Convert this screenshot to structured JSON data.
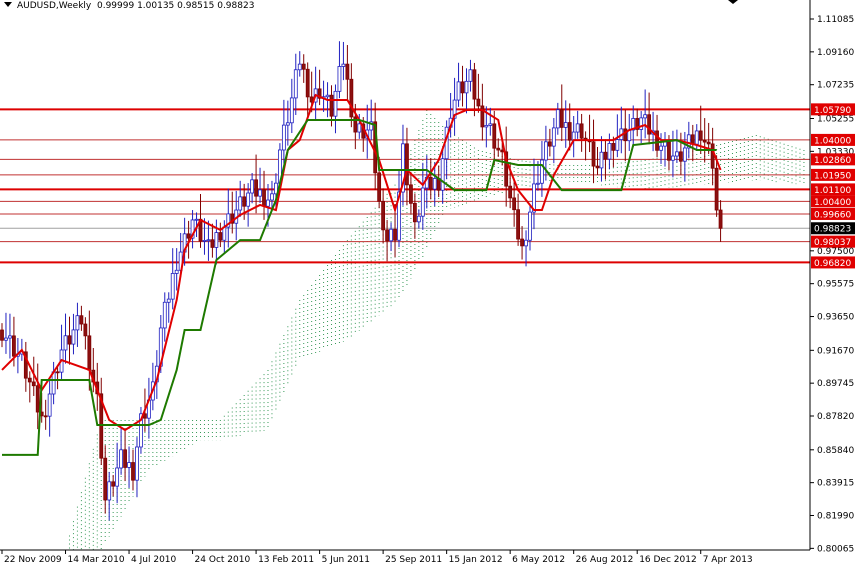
{
  "header": {
    "symbol": "AUDUSD,Weekly",
    "ohlc": "0.99999 1.00135 0.98515 0.98823"
  },
  "chart_data": {
    "type": "candlestick",
    "title": "AUDUSD,Weekly",
    "x_unit": "weeks since 22 Nov 2009",
    "ylim": [
      0.7997,
      1.1218
    ],
    "y_ticks": [
      "1.11085",
      "1.09160",
      "1.07235",
      "1.05255",
      "1.03330",
      "0.97500",
      "0.95575",
      "0.93650",
      "0.91670",
      "0.89745",
      "0.87820",
      "0.85840",
      "0.83915",
      "0.81990",
      "0.80065"
    ],
    "x_ticks": [
      {
        "week": 0,
        "label": "22 Nov 2009"
      },
      {
        "week": 16,
        "label": "14 Mar 2010"
      },
      {
        "week": 32,
        "label": "4 Jul 2010"
      },
      {
        "week": 48,
        "label": "24 Oct 2010"
      },
      {
        "week": 64,
        "label": "13 Feb 2011"
      },
      {
        "week": 80,
        "label": "5 Jun 2011"
      },
      {
        "week": 96,
        "label": "25 Sep 2011"
      },
      {
        "week": 112,
        "label": "15 Jan 2012"
      },
      {
        "week": 128,
        "label": "6 May 2012"
      },
      {
        "week": 144,
        "label": "26 Aug 2012"
      },
      {
        "week": 160,
        "label": "16 Dec 2012"
      },
      {
        "week": 176,
        "label": "7 Apr 2013"
      }
    ],
    "current_price": {
      "value": 0.98823,
      "label": "0.98823"
    },
    "levels": [
      {
        "value": 1.0579,
        "label": "1.05790",
        "thick": true
      },
      {
        "value": 1.04,
        "label": "1.04000",
        "thick": false
      },
      {
        "value": 1.0286,
        "label": "1.02860",
        "thick": false
      },
      {
        "value": 1.0195,
        "label": "1.01950",
        "thick": false
      },
      {
        "value": 1.011,
        "label": "1.01100",
        "thick": true
      },
      {
        "value": 1.004,
        "label": "1.00400",
        "thick": false
      },
      {
        "value": 0.9966,
        "label": "0.99660",
        "thick": false
      },
      {
        "value": 0.98037,
        "label": "0.98037",
        "thick": false
      },
      {
        "value": 0.9682,
        "label": "0.96820",
        "thick": true
      }
    ],
    "close_keypoints": [
      [
        0,
        0.9286
      ],
      [
        5,
        0.911
      ],
      [
        10,
        0.8759
      ],
      [
        15,
        0.9169
      ],
      [
        20,
        0.9345
      ],
      [
        24,
        0.8876
      ],
      [
        26,
        0.829
      ],
      [
        30,
        0.8524
      ],
      [
        33,
        0.8466
      ],
      [
        35,
        0.8759
      ],
      [
        38,
        0.8934
      ],
      [
        40,
        0.9286
      ],
      [
        44,
        0.9696
      ],
      [
        48,
        0.9931
      ],
      [
        52,
        0.9755
      ],
      [
        55,
        0.9872
      ],
      [
        59,
        0.9989
      ],
      [
        63,
        1.0106
      ],
      [
        68,
        1.0048
      ],
      [
        70,
        1.0341
      ],
      [
        73,
        1.0634
      ],
      [
        75,
        1.0868
      ],
      [
        78,
        1.0634
      ],
      [
        80,
        1.0692
      ],
      [
        83,
        1.0575
      ],
      [
        86,
        1.0868
      ],
      [
        89,
        1.0458
      ],
      [
        93,
        1.0458
      ],
      [
        96,
        0.9813
      ],
      [
        99,
        0.9872
      ],
      [
        101,
        1.0341
      ],
      [
        104,
        0.9872
      ],
      [
        106,
        1.0106
      ],
      [
        110,
        1.0165
      ],
      [
        113,
        1.0575
      ],
      [
        115,
        1.0692
      ],
      [
        118,
        1.0751
      ],
      [
        120,
        1.0575
      ],
      [
        123,
        1.0458
      ],
      [
        126,
        1.0282
      ],
      [
        129,
        0.9931
      ],
      [
        131,
        0.9755
      ],
      [
        134,
        1.0106
      ],
      [
        136,
        1.0282
      ],
      [
        140,
        1.0517
      ],
      [
        143,
        1.0458
      ],
      [
        146,
        1.0458
      ],
      [
        150,
        1.0224
      ],
      [
        154,
        1.0399
      ],
      [
        158,
        1.0458
      ],
      [
        161,
        1.0517
      ],
      [
        165,
        1.0399
      ],
      [
        170,
        1.0282
      ],
      [
        174,
        1.0399
      ],
      [
        176,
        1.0458
      ],
      [
        179,
        1.0282
      ],
      [
        180,
        0.9989
      ],
      [
        181,
        0.9882
      ]
    ],
    "series": [
      {
        "name": "Tenkan-sen",
        "color": "#e00000",
        "points": [
          [
            0,
            0.9052
          ],
          [
            5,
            0.9169
          ],
          [
            10,
            0.8934
          ],
          [
            15,
            0.911
          ],
          [
            22,
            0.9052
          ],
          [
            27,
            0.8759
          ],
          [
            31,
            0.87
          ],
          [
            35,
            0.8759
          ],
          [
            39,
            0.8993
          ],
          [
            44,
            0.9462
          ],
          [
            46,
            0.9755
          ],
          [
            50,
            0.9931
          ],
          [
            55,
            0.9872
          ],
          [
            60,
            0.996
          ],
          [
            65,
            1.0019
          ],
          [
            69,
            0.9989
          ],
          [
            72,
            1.0341
          ],
          [
            75,
            1.0399
          ],
          [
            79,
            1.0663
          ],
          [
            82,
            1.0634
          ],
          [
            87,
            1.0634
          ],
          [
            90,
            1.0517
          ],
          [
            95,
            1.0282
          ],
          [
            99,
            0.9989
          ],
          [
            102,
            1.0224
          ],
          [
            106,
            1.0136
          ],
          [
            110,
            1.0282
          ],
          [
            114,
            1.0546
          ],
          [
            117,
            1.0575
          ],
          [
            121,
            1.0575
          ],
          [
            125,
            1.0517
          ],
          [
            127,
            1.0282
          ],
          [
            130,
            1.0106
          ],
          [
            134,
            0.9989
          ],
          [
            136,
            0.9989
          ],
          [
            139,
            1.0194
          ],
          [
            144,
            1.0399
          ],
          [
            149,
            1.0399
          ],
          [
            154,
            1.0399
          ],
          [
            158,
            1.0458
          ],
          [
            162,
            1.0487
          ],
          [
            166,
            1.0399
          ],
          [
            170,
            1.0399
          ],
          [
            175,
            1.037
          ],
          [
            179,
            1.0341
          ],
          [
            181,
            1.0224
          ]
        ]
      },
      {
        "name": "Kijun-sen",
        "color": "#1e7a00",
        "points": [
          [
            0,
            0.8554
          ],
          [
            9,
            0.8554
          ],
          [
            10,
            0.8993
          ],
          [
            22,
            0.8993
          ],
          [
            24,
            0.8729
          ],
          [
            37,
            0.8729
          ],
          [
            40,
            0.8759
          ],
          [
            44,
            0.9052
          ],
          [
            46,
            0.9286
          ],
          [
            50,
            0.9286
          ],
          [
            54,
            0.9696
          ],
          [
            60,
            0.9813
          ],
          [
            65,
            0.9813
          ],
          [
            69,
            1.0048
          ],
          [
            72,
            1.0341
          ],
          [
            77,
            1.0517
          ],
          [
            90,
            1.0517
          ],
          [
            94,
            1.0487
          ],
          [
            95,
            1.0224
          ],
          [
            107,
            1.0224
          ],
          [
            114,
            1.0106
          ],
          [
            122,
            1.0106
          ],
          [
            124,
            1.0282
          ],
          [
            130,
            1.0253
          ],
          [
            136,
            1.0253
          ],
          [
            141,
            1.0106
          ],
          [
            156,
            1.0106
          ],
          [
            159,
            1.037
          ],
          [
            170,
            1.0399
          ],
          [
            175,
            1.0341
          ],
          [
            180,
            1.0341
          ]
        ]
      },
      {
        "name": "Senkou Span A",
        "color": "#1e9a40",
        "points": [
          [
            16,
            0.7997
          ],
          [
            25,
            0.8759
          ],
          [
            37,
            0.8759
          ],
          [
            50,
            0.8759
          ],
          [
            55,
            0.8759
          ],
          [
            67,
            0.9052
          ],
          [
            75,
            0.9462
          ],
          [
            87,
            0.9813
          ],
          [
            100,
            1.0165
          ],
          [
            107,
            1.0575
          ],
          [
            112,
            1.0458
          ],
          [
            120,
            1.0341
          ],
          [
            130,
            1.0282
          ],
          [
            140,
            1.0253
          ],
          [
            150,
            1.0253
          ],
          [
            162,
            1.0282
          ],
          [
            175,
            1.0341
          ],
          [
            190,
            1.0429
          ],
          [
            202,
            1.0341
          ]
        ]
      },
      {
        "name": "Senkou Span B",
        "color": "#1e9a40",
        "points": [
          [
            16,
            0.7997
          ],
          [
            25,
            0.7997
          ],
          [
            37,
            0.8466
          ],
          [
            50,
            0.8641
          ],
          [
            55,
            0.8641
          ],
          [
            67,
            0.87
          ],
          [
            75,
            0.911
          ],
          [
            87,
            0.9227
          ],
          [
            100,
            0.9462
          ],
          [
            107,
            0.9755
          ],
          [
            112,
            0.9989
          ],
          [
            120,
            1.0048
          ],
          [
            130,
            1.0106
          ],
          [
            140,
            1.0165
          ],
          [
            150,
            1.0136
          ],
          [
            162,
            1.0106
          ],
          [
            175,
            1.0136
          ],
          [
            190,
            1.0165
          ],
          [
            202,
            1.0136
          ]
        ]
      }
    ]
  }
}
